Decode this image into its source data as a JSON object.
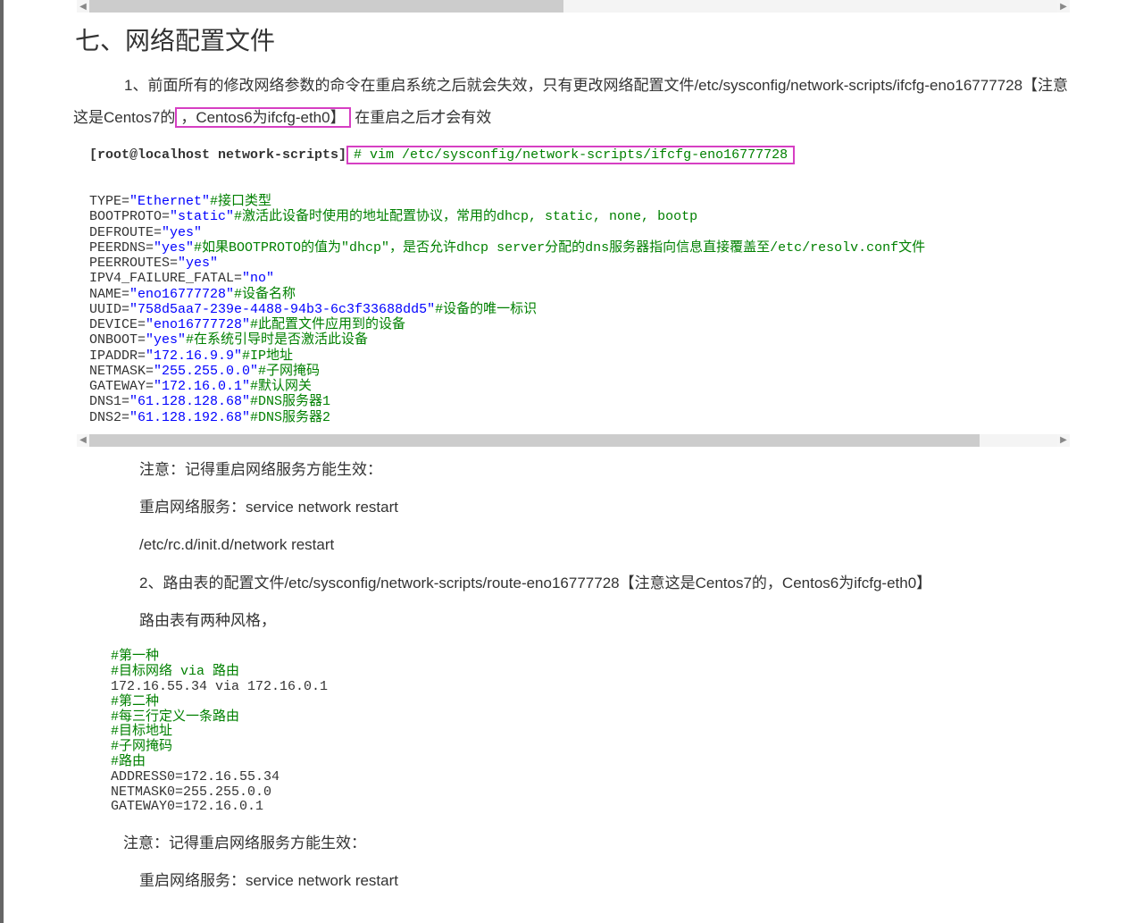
{
  "heading": "七、网络配置文件",
  "intro": {
    "prefix": "1、前面所有的修改网络参数的命令在重启系统之后就会失效，只有更改网络配置文件/etc/sysconfig/network-scripts/ifcfg-eno16777728【注意这是Centos7的",
    "highlight": "，Centos6为ifcfg-eth0】",
    "suffix": " 在重启之后才会有效"
  },
  "cmd": {
    "prompt": "[root@localhost network-scripts]",
    "command": "# vim /etc/sysconfig/network-scripts/ifcfg-eno16777728"
  },
  "cfg": {
    "l1a": "TYPE=",
    "l1b": "\"Ethernet\"",
    "l1c": "#接口类型",
    "l2a": "BOOTPROTO=",
    "l2b": "\"static\"",
    "l2c": "#激活此设备时使用的地址配置协议，常用的dhcp, static, none, bootp",
    "l3a": "DEFROUTE=",
    "l3b": "\"yes\"",
    "l4a": "PEERDNS=",
    "l4b": "\"yes\"",
    "l4c": "#如果BOOTPROTO的值为\"dhcp\"，是否允许dhcp server分配的dns服务器指向信息直接覆盖至/etc/resolv.conf文件",
    "l5a": "PEERROUTES=",
    "l5b": "\"yes\"",
    "l6a": "IPV4_FAILURE_FATAL=",
    "l6b": "\"no\"",
    "l7a": "NAME=",
    "l7b": "\"eno16777728\"",
    "l7c": "#设备名称",
    "l8a": "UUID=",
    "l8b": "\"758d5aa7-239e-4488-94b3-6c3f33688dd5\"",
    "l8c": "#设备的唯一标识",
    "l9a": "DEVICE=",
    "l9b": "\"eno16777728\"",
    "l9c": "#此配置文件应用到的设备",
    "l10a": "ONBOOT=",
    "l10b": "\"yes\"",
    "l10c": "#在系统引导时是否激活此设备",
    "l11a": "IPADDR=",
    "l11b": "\"172.16.9.9\"",
    "l11c": "#IP地址",
    "l12a": "NETMASK=",
    "l12b": "\"255.255.0.0\"",
    "l12c": "#子网掩码",
    "l13a": "GATEWAY=",
    "l13b": "\"172.16.0.1\"",
    "l13c": "#默认网关",
    "l14a": "DNS1=",
    "l14b": "\"61.128.128.68\"",
    "l14c": "#DNS服务器1",
    "l15a": "DNS2=",
    "l15b": "\"61.128.192.68\"",
    "l15c": "#DNS服务器2"
  },
  "notes1": {
    "n1": "注意：记得重启网络服务方能生效：",
    "n2": "重启网络服务：service network restart",
    "n3": "/etc/rc.d/init.d/network restart",
    "n4": "2、路由表的配置文件/etc/sysconfig/network-scripts/route-eno16777728【注意这是Centos7的，Centos6为ifcfg-eth0】",
    "n5": "路由表有两种风格，"
  },
  "route": {
    "c1": "#第一种",
    "c2": "#目标网络 via 路由",
    "l1": "172.16.55.34 via 172.16.0.1",
    "c3": "#第二种",
    "c4": "#每三行定义一条路由",
    "c5": "#目标地址",
    "c6": "#子网掩码",
    "c7": "#路由",
    "l2": "ADDRESS0=172.16.55.34",
    "l3": "NETMASK0=255.255.0.0",
    "l4": "GATEWAY0=172.16.0.1"
  },
  "notes2": {
    "n1": "注意：记得重启网络服务方能生效：",
    "n2": "重启网络服务：service network restart"
  }
}
